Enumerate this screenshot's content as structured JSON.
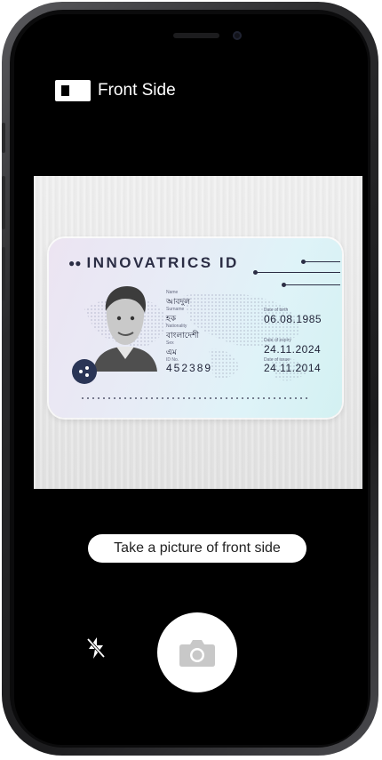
{
  "header": {
    "title": "Front Side",
    "icon": "card-side-icon"
  },
  "camera": {
    "hint": "Take a picture of front side",
    "flash_icon": "flash-off-icon",
    "shutter_icon": "camera-icon"
  },
  "id_card": {
    "brand": "INNOVATRICS ID",
    "name_label": "Name",
    "name_value": "আবদুল",
    "surname_label": "Surname",
    "surname_value": "হক",
    "nationality_label": "Nationality",
    "nationality_value": "বাংলাদেশী",
    "sex_label": "Sex",
    "sex_value": "এম",
    "id_label": "ID No.",
    "id_value": "452389",
    "dob_label": "Date of birth",
    "dob_value": "06.08.1985",
    "expiry_label": "Date of expiry",
    "expiry_value": "24.11.2024",
    "issue_label": "Date of issue",
    "issue_value": "24.11.2014"
  },
  "colors": {
    "frame": "#1c1c1e",
    "screen": "#000000",
    "card_text": "#2b2d44",
    "chip": "#2a3556"
  }
}
